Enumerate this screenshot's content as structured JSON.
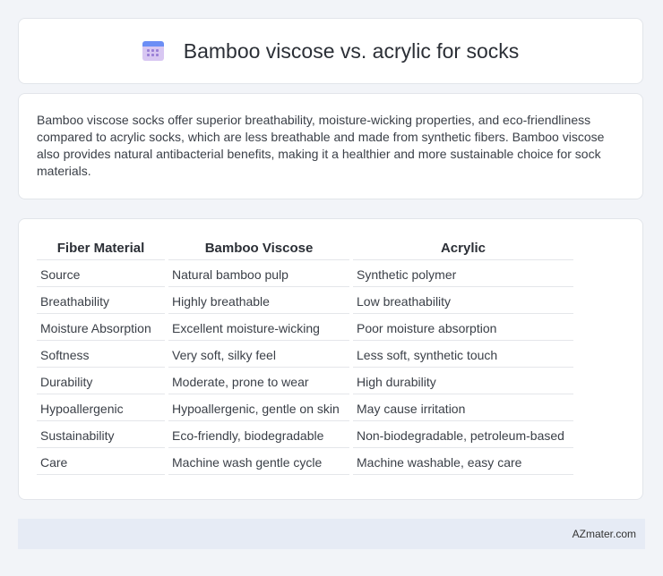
{
  "header": {
    "icon": "calendar-icon",
    "title": "Bamboo viscose vs. acrylic for socks"
  },
  "intro": {
    "text": "Bamboo viscose socks offer superior breathability, moisture-wicking properties, and eco-friendliness compared to acrylic socks, which are less breathable and made from synthetic fibers. Bamboo viscose also provides natural antibacterial benefits, making it a healthier and more sustainable choice for sock materials."
  },
  "table": {
    "headers": [
      "Fiber Material",
      "Bamboo Viscose",
      "Acrylic"
    ],
    "rows": [
      [
        "Source",
        "Natural bamboo pulp",
        "Synthetic polymer"
      ],
      [
        "Breathability",
        "Highly breathable",
        "Low breathability"
      ],
      [
        "Moisture Absorption",
        "Excellent moisture-wicking",
        "Poor moisture absorption"
      ],
      [
        "Softness",
        "Very soft, silky feel",
        "Less soft, synthetic touch"
      ],
      [
        "Durability",
        "Moderate, prone to wear",
        "High durability"
      ],
      [
        "Hypoallergenic",
        "Hypoallergenic, gentle on skin",
        "May cause irritation"
      ],
      [
        "Sustainability",
        "Eco-friendly, biodegradable",
        "Non-biodegradable, petroleum-based"
      ],
      [
        "Care",
        "Machine wash gentle cycle",
        "Machine washable, easy care"
      ]
    ]
  },
  "footer": {
    "brand": "AZmater.com"
  }
}
